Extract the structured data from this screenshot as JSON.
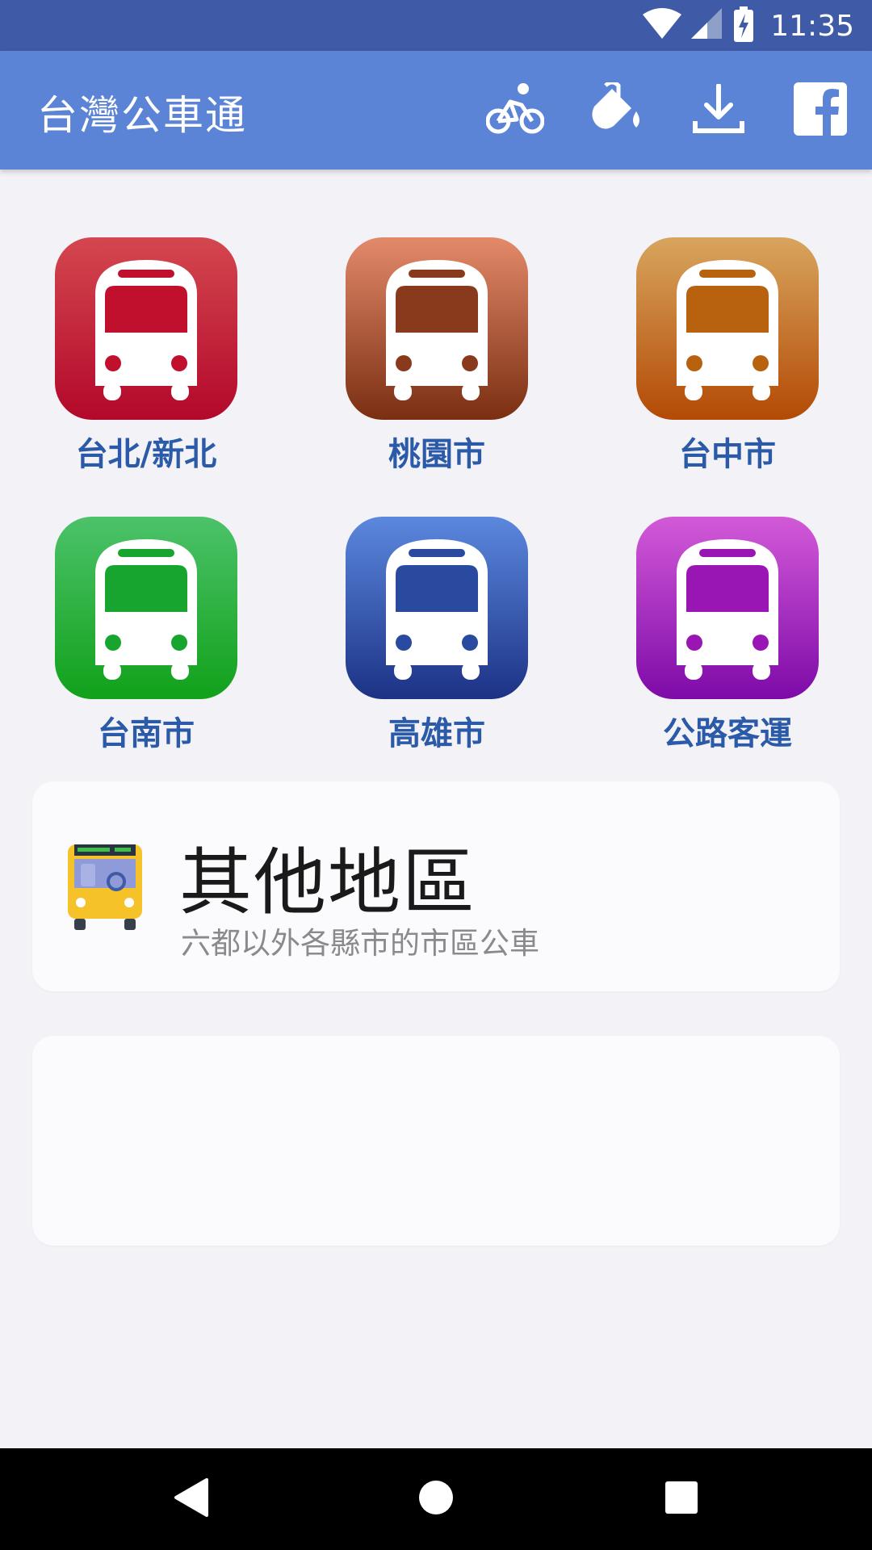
{
  "status_bar": {
    "time": "11:35",
    "icons": [
      "wifi-icon",
      "signal-icon",
      "battery-charging-icon"
    ]
  },
  "app_bar": {
    "title": "台灣公車通",
    "actions": [
      "bicycle-icon",
      "paint-bucket-icon",
      "download-icon",
      "facebook-icon"
    ]
  },
  "cities": [
    {
      "label": "台北/新北",
      "color_top": "#d4474f",
      "color_bottom": "#b3082a",
      "accent": "#c0102e"
    },
    {
      "label": "桃園市",
      "color_top": "#e38a6a",
      "color_bottom": "#7a2e12",
      "accent": "#8a3a1c"
    },
    {
      "label": "台中市",
      "color_top": "#d8a55e",
      "color_bottom": "#b34a05",
      "accent": "#b8610e"
    },
    {
      "label": "台南市",
      "color_top": "#4cc26a",
      "color_bottom": "#11a11a",
      "accent": "#17a530"
    },
    {
      "label": "高雄市",
      "color_top": "#5b88de",
      "color_bottom": "#1c3285",
      "accent": "#2a4aa0"
    },
    {
      "label": "公路客運",
      "color_top": "#d25ad8",
      "color_bottom": "#7e0aa8",
      "accent": "#9a16b4"
    }
  ],
  "other_card": {
    "title": "其他地區",
    "subtitle": "六都以外各縣市的市區公車",
    "icon": "yellow-bus-icon"
  },
  "nav_bar": {
    "buttons": [
      "back-icon",
      "home-icon",
      "recents-icon"
    ]
  }
}
